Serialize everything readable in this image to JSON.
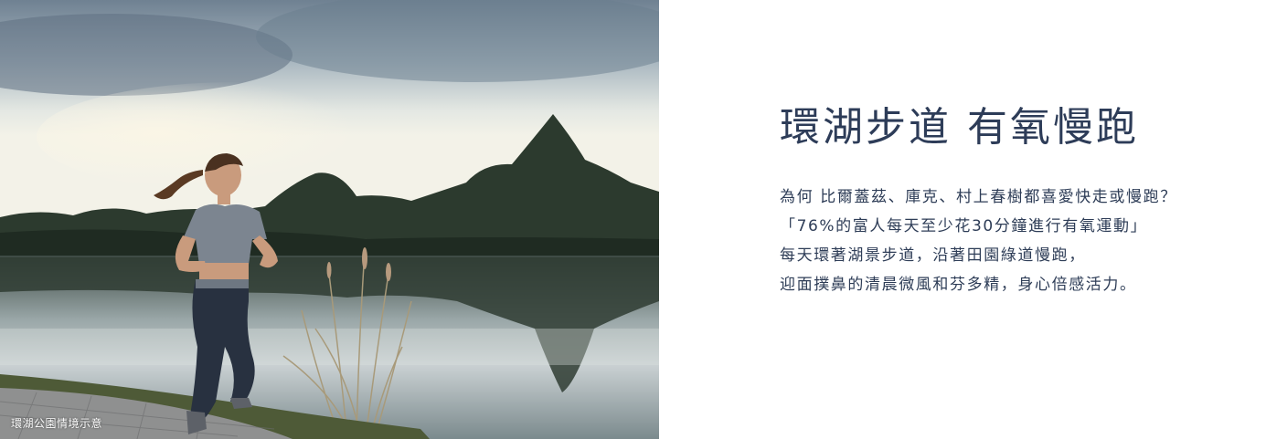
{
  "photo": {
    "caption": "環湖公園情境示意",
    "subject_icon": "woman-jogging-by-lake-photo"
  },
  "text": {
    "headline": "環湖步道 有氧慢跑",
    "lines": [
      "為何 比爾蓋茲、庫克、村上春樹都喜愛快走或慢跑？",
      "「76%的富人每天至少花30分鐘進行有氧運動」",
      "每天環著湖景步道，沿著田園綠道慢跑，",
      "迎面撲鼻的清晨微風和芬多精，身心倍感活力。"
    ]
  },
  "colors": {
    "text": "#2e3d57",
    "background": "#ffffff"
  }
}
